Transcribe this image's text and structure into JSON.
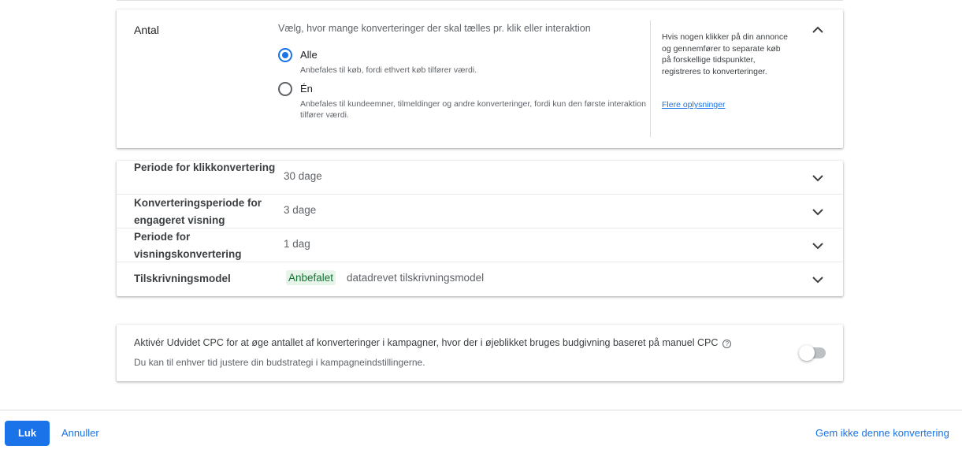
{
  "antal": {
    "title": "Antal",
    "description": "Vælg, hvor mange konverteringer der skal tælles pr. klik eller interaktion",
    "options": [
      {
        "label": "Alle",
        "sub": "Anbefales til køb, fordi ethvert køb tilfører værdi.",
        "selected": true
      },
      {
        "label": "Én",
        "sub": "Anbefales til kundeemner, tilmeldinger og andre konverteringer, fordi kun den første interaktion tilfører værdi.",
        "selected": false
      }
    ],
    "help_text": "Hvis nogen klikker på din annonce og gennemfører to separate køb på forskellige tidspunkter, registreres to konverteringer.",
    "help_link": "Flere oplysninger"
  },
  "settings": [
    {
      "title": "Periode for klikkonvertering",
      "value": "30 dage"
    },
    {
      "title": "Konverteringsperiode for engageret visning",
      "value": "3 dage"
    },
    {
      "title": "Periode for visningskonvertering",
      "value": "1 dag"
    },
    {
      "title": "Tilskrivningsmodel",
      "badge": "Anbefalet",
      "value": "datadrevet tilskrivningsmodel"
    }
  ],
  "cpc": {
    "text": "Aktivér Udvidet CPC for at øge antallet af konverteringer i kampagner, hvor der i øjeblikket bruges budgivning baseret på manuel CPC",
    "subtext": "Du kan til enhver tid justere din budstrategi i kampagneindstillingerne.",
    "enabled": false
  },
  "footer": {
    "primary": "Luk",
    "cancel": "Annuller",
    "dont_save": "Gem ikke denne konvertering"
  },
  "colors": {
    "accent": "#1a73e8",
    "badge_bg": "#e6f4ea",
    "badge_text": "#137333"
  }
}
